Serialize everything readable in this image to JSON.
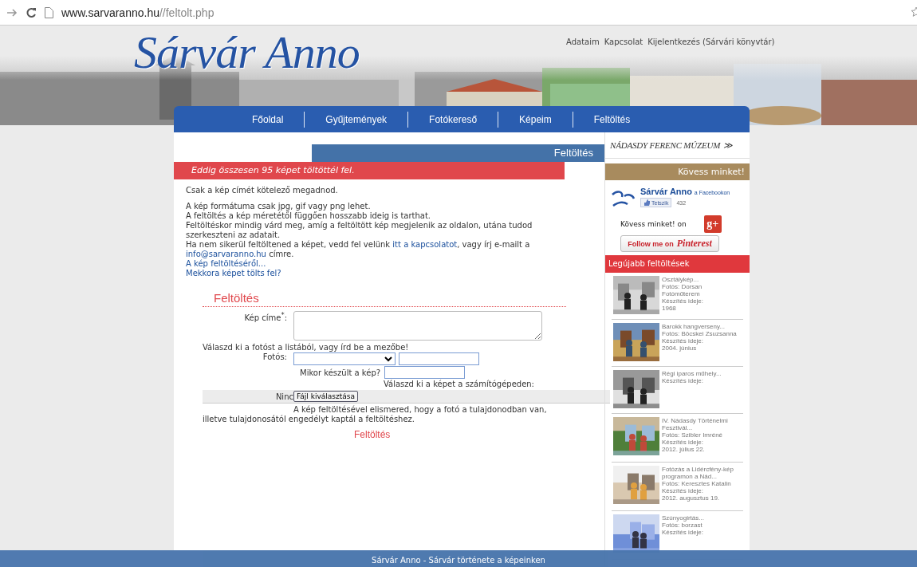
{
  "browser": {
    "url_host": "www.sarvaranno.hu",
    "url_path": "//feltolt.php"
  },
  "header": {
    "logo": "Sárvár Anno",
    "links": [
      "Adataim",
      "Kapcsolat",
      "Kijelentkezés (Sárvári könyvtár)"
    ]
  },
  "nav": [
    "Főoldal",
    "Gyűjtemények",
    "Fotókereső",
    "Képeim",
    "Feltöltés"
  ],
  "page_title": "Feltöltés",
  "notice": "Eddig összesen 95 képet töltöttél fel.",
  "intro": "Csak a kép címét kötelező megadnod.",
  "info": [
    [
      {
        "text": "A kép formátuma csak jpg, gif vagy png lehet."
      }
    ],
    [
      {
        "text": "A feltöltés a kép méretétől függően hosszabb ideig is tarthat."
      }
    ],
    [
      {
        "text": "Feltöltéskor mindig várd meg, amíg a feltöltött kép megjelenik az oldalon, utána tudod szerkeszteni az adatait."
      }
    ],
    [
      {
        "text": "Ha nem sikerül feltöltened a képet, vedd fel velünk "
      },
      {
        "text": "itt a kapcsolatot",
        "link": true
      },
      {
        "text": ", vagy írj e-mailt a "
      },
      {
        "text": "info@sarvaranno.hu",
        "link": true
      },
      {
        "text": " címre."
      }
    ],
    [
      {
        "text": "A kép feltöltéséről...",
        "link": true
      }
    ],
    [
      {
        "text": "Mekkora képet tölts fel?",
        "link": true
      }
    ]
  ],
  "form": {
    "title": "Feltöltés",
    "title_label": "Kép címe$^{*}$:",
    "photographer_hint": "Válaszd ki a fotóst a listából, vagy írd be a mezőbe!",
    "photographer_label": "Fotós:",
    "date_label": "Mikor készült a kép?",
    "file_hint": "Válaszd ki a képet a számítógépeden:",
    "file_status": "Ninc",
    "file_button": "Fájl kiválasztása",
    "consent": "A kép feltöltésével elismered, hogy a fotó a tulajdonodban van, illetve tulajdonosától engedélyt kaptál a feltöltéshez.",
    "submit": "Feltöltés"
  },
  "sidebar": {
    "museum": "NÁDASDY FERENC MÚZEUM",
    "museum_arrow": "≫",
    "follow_title": "Kövess minket!",
    "facebook": {
      "page": "Sárvár Anno",
      "suffix": "a Facebookon",
      "like": "Tetszik",
      "count": "432"
    },
    "gplus_text": "Kövess minket! on",
    "gplus_icon": "g+",
    "pinterest_prefix": "Follow me on",
    "pinterest_brand": "Pinterest",
    "latest_title": "Legújabb feltöltések",
    "latest": [
      {
        "lines": [
          "Osztálykép...",
          "Fotós: Dorsan Fotóműterem",
          "Készítés ideje:",
          "1968"
        ]
      },
      {
        "lines": [
          "Barokk hangverseny...",
          "Fotós: Böcskei Zsuzsanna",
          "Készítés ideje:",
          "2004. június"
        ]
      },
      {
        "lines": [
          "Régi iparos műhely...",
          "Készítés ideje:"
        ]
      },
      {
        "lines": [
          "IV. Nádasdy Történelmi Fesztivál...",
          "Fotós: Szibler Imréné",
          "Készítés ideje:",
          "2012. július 22."
        ]
      },
      {
        "lines": [
          "Fotózás a Lidércfény-kép programon a Nád...",
          "Fotós: Keresztes Katalin",
          "Készítés ideje:",
          "2012. augusztus 19."
        ]
      },
      {
        "lines": [
          "Szúnyogirtás...",
          "Fotós: borzast",
          "Készítés ideje:"
        ]
      }
    ]
  },
  "footer": "Sárvár Anno - Sárvár története a képeinken"
}
